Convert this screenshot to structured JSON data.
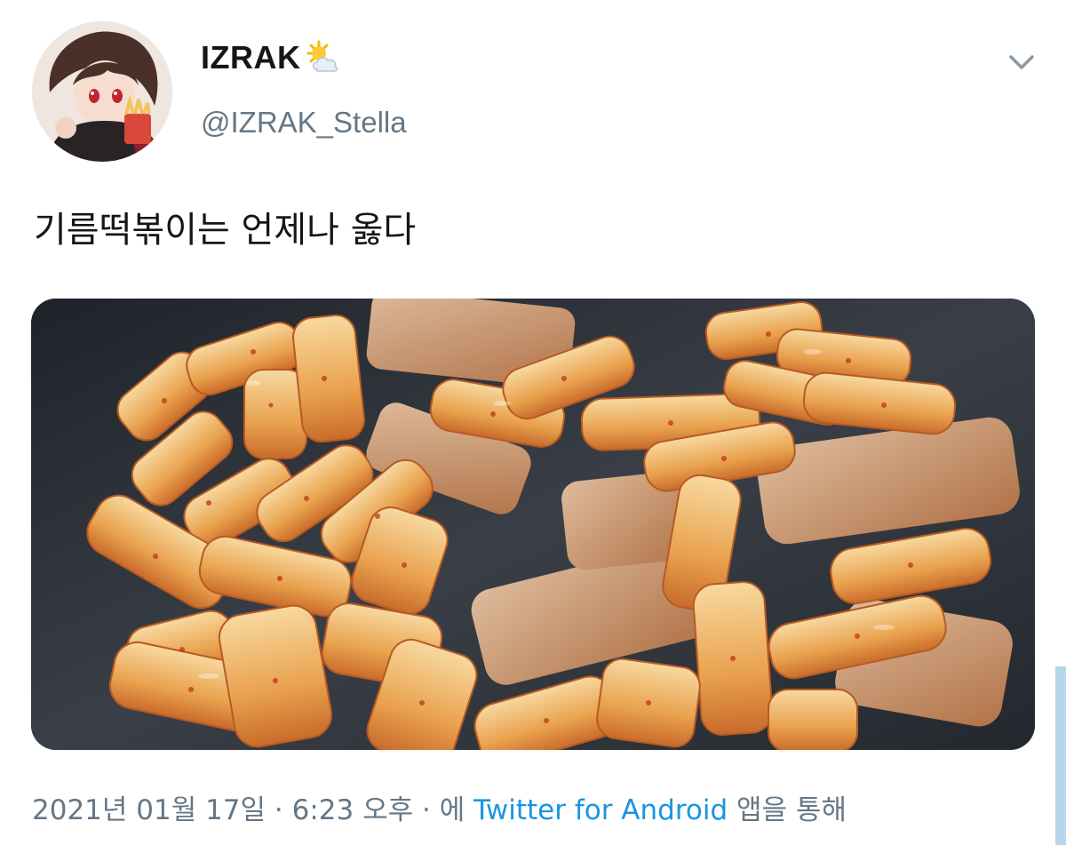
{
  "author": {
    "display_name": "IZRAK",
    "display_name_emoji": "sun-behind-cloud-icon",
    "handle": "@IZRAK_Stella"
  },
  "tweet": {
    "text": "기름떡볶이는 언제나 옳다"
  },
  "meta": {
    "date": "2021년 01월 17일",
    "sep1": " · ",
    "time": "6:23 오후",
    "sep2": " · ",
    "via_prefix": "에 ",
    "source": "Twitter for Android",
    "via_suffix": " 앱을 통해"
  },
  "colors": {
    "text_primary": "#14171a",
    "text_secondary": "#657786",
    "link": "#1b95e0"
  }
}
